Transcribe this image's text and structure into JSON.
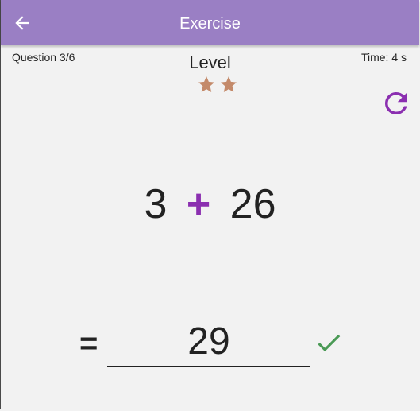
{
  "header": {
    "title": "Exercise",
    "background": "#9a7fc4",
    "back_icon": "arrow-left-icon"
  },
  "status": {
    "question": "Question 3/6",
    "time": "Time: 4 s"
  },
  "level": {
    "label": "Level",
    "stars": 2,
    "star_color": "#c48a6a"
  },
  "refresh": {
    "icon": "refresh-icon",
    "color": "#8b2fb0"
  },
  "problem": {
    "left": "3",
    "operator": "+",
    "right": "26",
    "operator_color": "#8b2fb0"
  },
  "answer": {
    "equals": "=",
    "value": "29",
    "check_icon": "checkmark-icon",
    "check_color": "#4a9a55"
  }
}
